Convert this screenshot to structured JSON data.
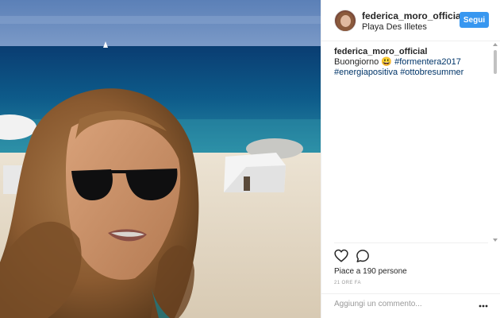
{
  "post": {
    "username": "federica_moro_official",
    "location": "Playa Des Illetes",
    "follow_label": "Segui",
    "caption": {
      "username": "federica_moro_official",
      "text": " Buongiorno 😃",
      "hashtags": [
        "#formentera2017",
        "#energiapositiva",
        "#ottobresummer"
      ]
    },
    "likes": "Piace a 190 persone",
    "timestamp": "21 ORE FA",
    "comment_placeholder": "Aggiungi un commento...",
    "colors": {
      "follow": "#3897f0",
      "hashtag": "#003569",
      "text": "#262626"
    },
    "icons": {
      "like": "heart-icon",
      "comment": "comment-icon",
      "more": "more-options-icon"
    },
    "photo": "selfie-on-beach-image"
  }
}
